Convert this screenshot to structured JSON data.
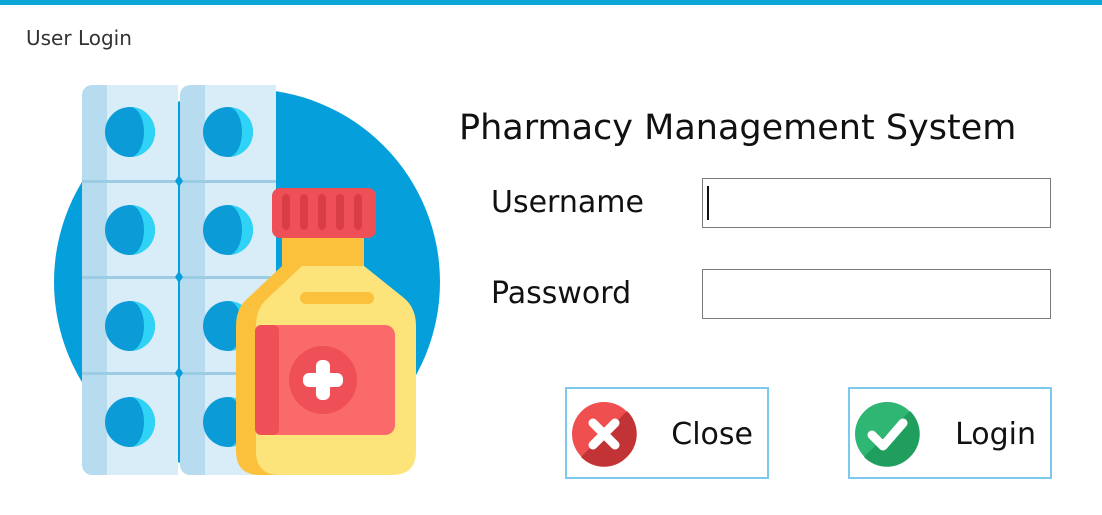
{
  "window": {
    "title": "User Login"
  },
  "app": {
    "title": "Pharmacy Management System"
  },
  "form": {
    "username_label": "Username",
    "username_value": "",
    "password_label": "Password",
    "password_value": ""
  },
  "buttons": {
    "close_label": "Close",
    "close_icon": "close-icon",
    "login_label": "Login",
    "login_icon": "check-icon"
  },
  "illustration": {
    "icon": "pharmacy-icon"
  },
  "colors": {
    "accent": "#0aa6d6",
    "button_border": "#7cc9ee",
    "close_red": "#ef4f4f",
    "login_green": "#2fb673"
  }
}
